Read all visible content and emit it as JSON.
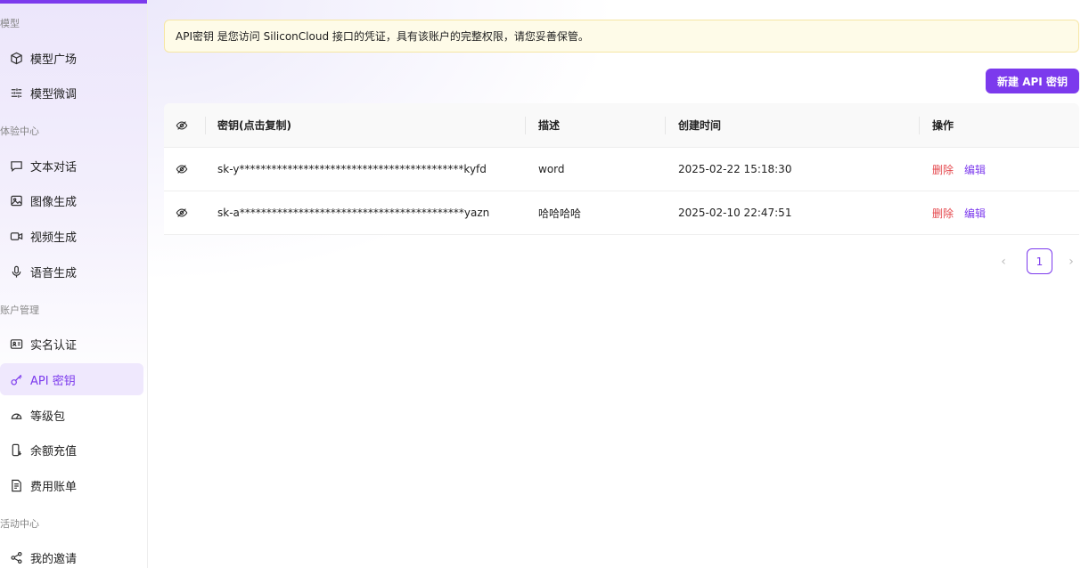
{
  "sidebar": {
    "sections": [
      {
        "title": "模型",
        "items": [
          {
            "label": "模型广场",
            "icon": "cube-icon"
          },
          {
            "label": "模型微调",
            "icon": "sliders-icon"
          }
        ]
      },
      {
        "title": "体验中心",
        "items": [
          {
            "label": "文本对话",
            "icon": "chat-icon"
          },
          {
            "label": "图像生成",
            "icon": "image-icon"
          },
          {
            "label": "视频生成",
            "icon": "video-icon"
          },
          {
            "label": "语音生成",
            "icon": "mic-icon"
          }
        ]
      },
      {
        "title": "账户管理",
        "items": [
          {
            "label": "实名认证",
            "icon": "id-card-icon"
          },
          {
            "label": "API 密钥",
            "icon": "key-icon",
            "active": true
          },
          {
            "label": "等级包",
            "icon": "gauge-icon"
          },
          {
            "label": "余额充值",
            "icon": "phone-recharge-icon"
          },
          {
            "label": "费用账单",
            "icon": "bill-icon"
          }
        ]
      },
      {
        "title": "活动中心",
        "items": [
          {
            "label": "我的邀请",
            "icon": "share-icon"
          }
        ]
      }
    ]
  },
  "notice": {
    "text": "API密钥 是您访问 SiliconCloud 接口的凭证，具有该账户的完整权限，请您妥善保管。"
  },
  "toolbar": {
    "new_key_label": "新建 API 密钥"
  },
  "table": {
    "headers": {
      "key": "密钥(点击复制)",
      "desc": "描述",
      "time": "创建时间",
      "ops": "操作"
    },
    "rows": [
      {
        "key": "sk-y******************************************kyfd",
        "desc": "word",
        "time": "2025-02-22 15:18:30",
        "delete": "删除",
        "edit": "编辑"
      },
      {
        "key": "sk-a******************************************yazn",
        "desc": "哈哈哈哈",
        "time": "2025-02-10 22:47:51",
        "delete": "删除",
        "edit": "编辑"
      }
    ]
  },
  "pagination": {
    "current": "1"
  },
  "colors": {
    "accent": "#7c3aed",
    "danger": "#e5484d",
    "notice_bg": "#fefbe8"
  }
}
